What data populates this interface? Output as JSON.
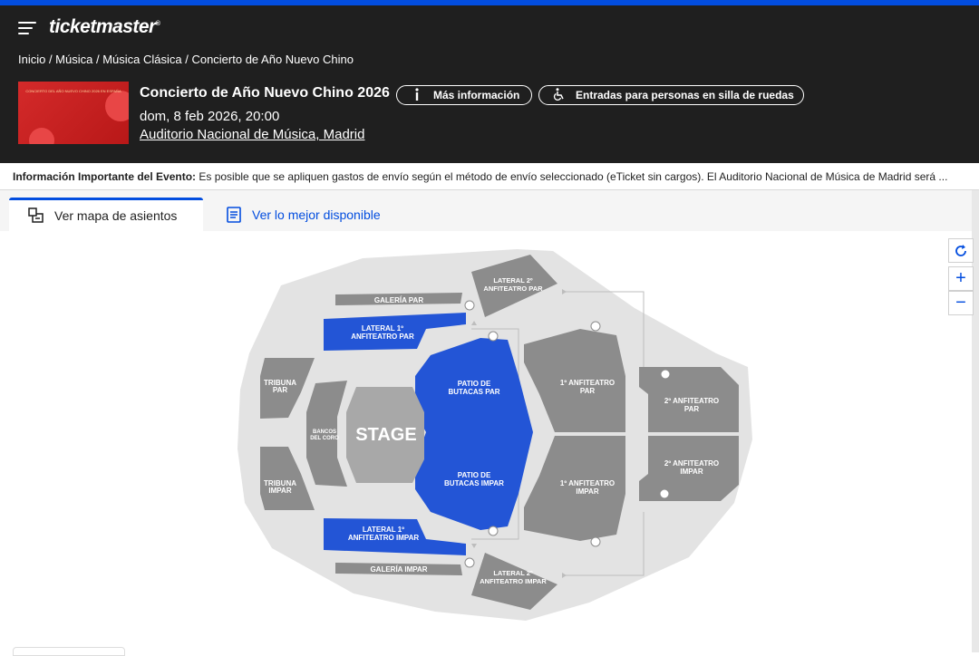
{
  "brand": {
    "logo_text": "ticketmaster",
    "accent_color": "#024ddf",
    "header_bg": "#1f1f1f"
  },
  "breadcrumb": "Inicio / Música / Música Clásica / Concierto de Año Nuevo Chino",
  "event": {
    "title": "Concierto de Año Nuevo Chino 2026",
    "date": "dom, 8 feb 2026, 20:00",
    "venue": "Auditorio Nacional de Música, Madrid",
    "thumbnail_text": "CONCIERTO DEL AÑO NUEVO CHINO 2026 EN ESPAÑA"
  },
  "buttons": {
    "more_info": "Más información",
    "wheelchair": "Entradas para personas en silla de ruedas"
  },
  "info_bar": {
    "label": "Información Importante del Evento:",
    "text": " Es posible que se apliquen gastos de envío según el método de envío seleccionado (eTicket sin cargos). El Auditorio Nacional de Música de Madrid será ..."
  },
  "tabs": [
    {
      "label": "Ver mapa de asientos",
      "active": true,
      "icon": "seat-map-icon"
    },
    {
      "label": "Ver lo mejor disponible",
      "active": false,
      "icon": "list-icon"
    }
  ],
  "map_controls": {
    "reset": "↻",
    "zoom_in": "+",
    "zoom_out": "−"
  },
  "map": {
    "colors": {
      "available": "#2355d6",
      "unavailable": "#8c8c8c",
      "venue": "#e3e3e3",
      "stage": "#a8a8a8"
    },
    "stage": "STAGE",
    "sections": {
      "galeria_par": "GALERÍA PAR",
      "lateral2_par": "LATERAL 2º ANFITEATRO PAR",
      "lateral1_par": "LATERAL 1º ANFITEATRO PAR",
      "patio_par": "PATIO DE BUTACAS PAR",
      "tribuna_par": "TRIBUNA PAR",
      "tribuna_impar": "TRIBUNA IMPAR",
      "bancos_coro": "BANCOS DEL CORO",
      "patio_impar": "PATIO DE BUTACAS IMPAR",
      "anf1_par": "1º ANFITEATRO PAR",
      "anf1_impar": "1º ANFITEATRO IMPAR",
      "anf2_par": "2º ANFITEATRO PAR",
      "anf2_impar": "2º ANFITEATRO IMPAR",
      "lateral1_impar": "LATERAL 1º ANFITEATRO IMPAR",
      "galeria_impar": "GALERÍA IMPAR",
      "lateral2_impar": "LATERAL 2º ANFITEATRO IMPAR"
    }
  }
}
